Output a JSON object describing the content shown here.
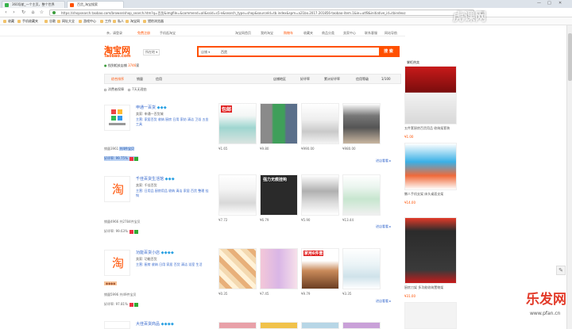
{
  "browser": {
    "tabs": [
      {
        "label": "360导航_一个主页，整个世界"
      },
      {
        "label": "百货_淘宝搜索"
      }
    ],
    "window_controls": [
      "—",
      "□",
      "✕"
    ],
    "url": "https://shopsearch.taobao.com/browse/shop_search.htm?q=百货&imgfile=&commend=all&ssid=s5-e&search_type=shop&sourceId=tb.index&spm=a21bo.2017.201856-taobao-item.1&ie=utf8&initiative_id=tbindexz",
    "bookmarks": [
      "收藏",
      "手机收藏夹",
      "谷歌",
      "网址大全",
      "游戏中心",
      "工作",
      "私人",
      "淘宝网",
      "猎豹浏览器"
    ]
  },
  "watermark": {
    "top": "虎课网",
    "logo": "乐发网",
    "url": "www.pfan.cn"
  },
  "taobao": {
    "topnav": [
      "亲，请登录",
      "免费注册",
      "手机逛淘宝",
      "淘宝网首页",
      "我的淘宝",
      "购物车",
      "收藏夹",
      "商品分类",
      "卖家中心",
      "联系客服",
      "网站导航"
    ],
    "logo_cn": "淘宝网",
    "logo_en": "Taobao.com",
    "location": "所在地 ▾",
    "search_category": "店铺 ▾",
    "search_value": "百货",
    "search_button": "搜 索",
    "found_prefix": "找到相关店铺",
    "found_count": "3746",
    "found_suffix": "家",
    "sort_tabs": [
      "综合排序",
      "销量",
      "信用"
    ],
    "filters": [
      "店铺地区",
      "好评率",
      "累计好评率",
      "信用等级"
    ],
    "pager": "1/100",
    "checkboxes": [
      "消费者保障",
      "7天无理由"
    ],
    "shops": [
      {
        "name": "申通一百货",
        "info": "卖家: 申通一百货城",
        "desc": "主营: 家居百货 收纳 厨房 日用 家纺 清洁 卫浴 五金 工具",
        "sales": "销量3961",
        "sales_hl": "共4件宝贝",
        "rate": "好评率: 99.75%",
        "more": "进店看看 ▸",
        "products": [
          {
            "price": "¥1.65",
            "tag": "包邮"
          },
          {
            "price": "¥9.80",
            "tag": ""
          },
          {
            "price": "¥990.00",
            "tag": ""
          },
          {
            "price": "¥980.00",
            "tag": ""
          }
        ]
      },
      {
        "name": "千佳百货生活馆",
        "info": "卖家: 千佳百货",
        "desc": "主营: 日用品 厨房用品 收纳 清洁 家居 百货 整理 挂钩",
        "sales": "销量4966",
        "sales_hl": "共2784件宝贝",
        "rate": "好评率: 99.63%",
        "more": "进店看看 ▸",
        "products": [
          {
            "price": "¥7.72",
            "tag": ""
          },
          {
            "price": "¥6.79",
            "tag": "强力无痕挂钩"
          },
          {
            "price": "¥5.90",
            "tag": ""
          },
          {
            "price": "¥13.44",
            "tag": ""
          }
        ]
      },
      {
        "name": "功能百货小店",
        "info": "卖家: 功能百货",
        "desc": "主营: 厨房 收纳 日用 家居 百货 清洁 浴室 生活",
        "sales": "销量5996",
        "sales_hl": "共49件宝贝",
        "rate": "好评率: 97.81%",
        "more": "进店看看 ▸",
        "products": [
          {
            "price": "¥0.35",
            "tag": ""
          },
          {
            "price": "¥7.45",
            "tag": ""
          },
          {
            "price": "¥9.79",
            "tag": "家用6件套"
          },
          {
            "price": "¥3.35",
            "tag": ""
          }
        ]
      },
      {
        "name": "大佳百货商品",
        "info": "",
        "desc": "",
        "sales": "",
        "sales_hl": "",
        "rate": "",
        "more": "",
        "products": []
      }
    ],
    "ads": {
      "header": "掌柜热卖",
      "items": [
        {
          "caption": "五件套厨房百货用品 收纳架套装",
          "price": "¥1.00"
        },
        {
          "caption": "懒人手机支架 床头桌面支架",
          "price": "¥14.00"
        },
        {
          "caption": "厨房刀架 多功能收纳置物架",
          "price": "¥31.00"
        },
        {
          "caption": "",
          "price": ""
        }
      ]
    }
  }
}
